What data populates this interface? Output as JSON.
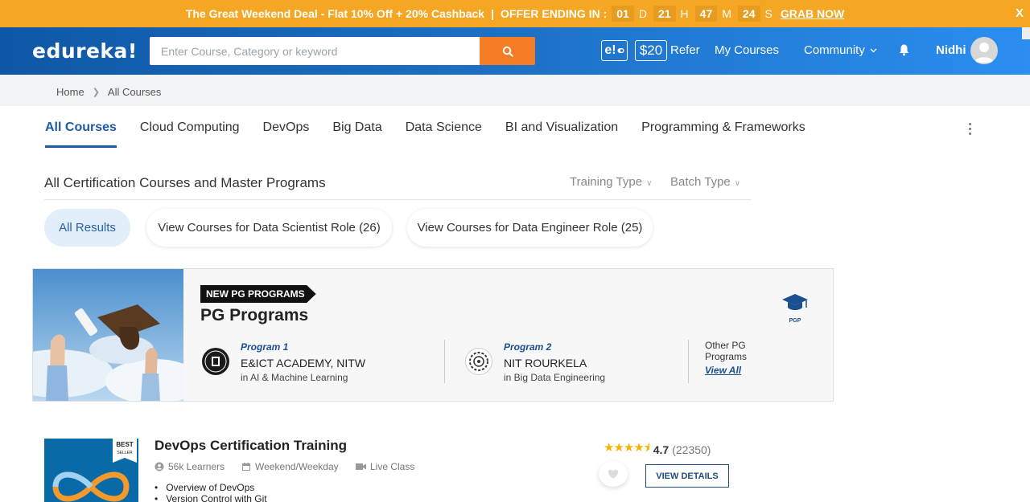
{
  "promo": {
    "text": "The Great Weekend Deal - Flat 10% Off + 20% Cashback",
    "separator": "|",
    "ending_label": "OFFER ENDING IN :",
    "countdown": [
      {
        "value": "01",
        "unit": "D"
      },
      {
        "value": "21",
        "unit": "H"
      },
      {
        "value": "47",
        "unit": "M"
      },
      {
        "value": "24",
        "unit": "S"
      }
    ],
    "cta": "GRAB NOW",
    "close": "X"
  },
  "header": {
    "logo": "edureka!",
    "search_placeholder": "Enter Course, Category or keyword",
    "badge": "e!",
    "refer_amount": "$20",
    "refer_label": "Refer",
    "my_courses": "My Courses",
    "community": "Community",
    "user_name": "Nidhi"
  },
  "breadcrumb": [
    "Home",
    "All Courses"
  ],
  "tabs": [
    "All Courses",
    "Cloud Computing",
    "DevOps",
    "Big Data",
    "Data Science",
    "BI and Visualization",
    "Programming & Frameworks"
  ],
  "section": {
    "title": "All Certification Courses and Master Programs",
    "filters": [
      "Training Type",
      "Batch Type"
    ]
  },
  "pills": [
    "All Results",
    "View Courses for Data Scientist Role (26)",
    "View Courses for Data Engineer Role (25)"
  ],
  "pg": {
    "tag": "NEW PG PROGRAMS",
    "title": "PG Programs",
    "icon_label": "PGP",
    "programs": [
      {
        "num": "Program 1",
        "name": "E&ICT ACADEMY, NITW",
        "sub": "in AI & Machine Learning"
      },
      {
        "num": "Program 2",
        "name": "NIT ROURKELA",
        "sub": "in Big Data Engineering"
      }
    ],
    "other_label": "Other PG Programs",
    "view_all": "View All"
  },
  "course": {
    "badge_title": "BEST",
    "badge_sub": "SELLER",
    "title": "DevOps Certification Training",
    "learners": "56k Learners",
    "schedule": "Weekend/Weekday",
    "mode": "Live Class",
    "bullets": [
      "Overview of DevOps",
      "Version Control with Git"
    ],
    "rating": "4.7",
    "rating_count": "(22350)",
    "cta": "VIEW DETAILS"
  },
  "colors": {
    "promo": "#f5a623",
    "header": "#1b6ec2",
    "search_btn": "#f57c22",
    "active_tab": "#1f5aa6"
  }
}
